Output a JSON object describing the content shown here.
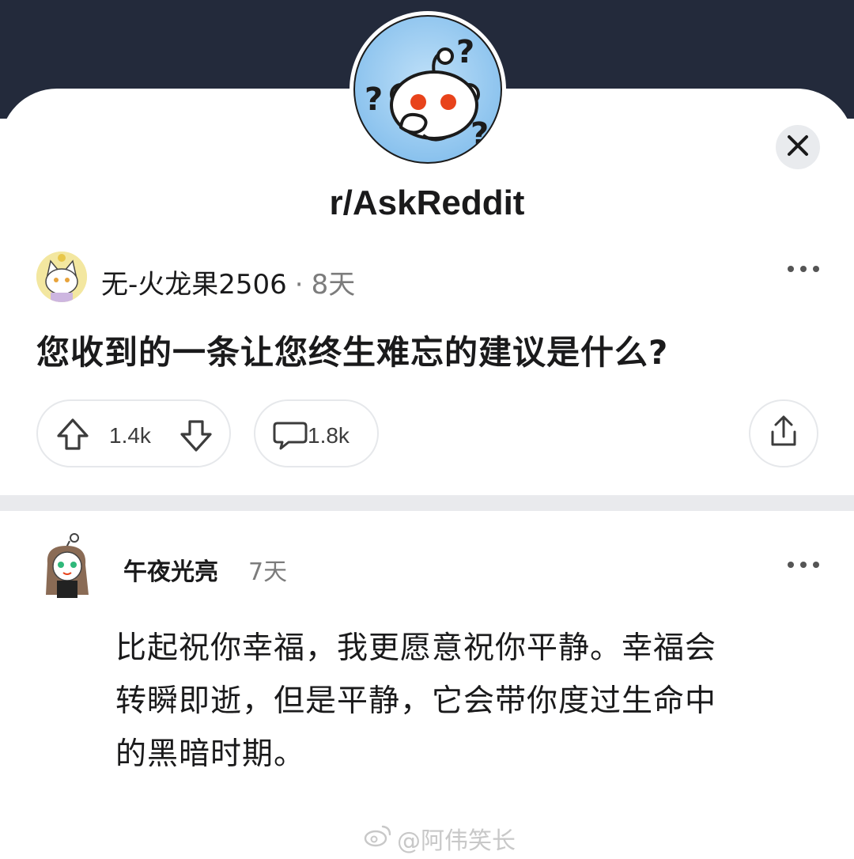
{
  "subreddit": {
    "name": "r/AskReddit"
  },
  "post": {
    "author": "无-火龙果2506",
    "separator": "·",
    "age": "8天",
    "title": "您收到的一条让您终生难忘的建议是什么?",
    "upvotes": "1.4k",
    "comments": "1.8k"
  },
  "comment": {
    "author": "午夜光亮",
    "age": "7天",
    "lines": [
      "比起祝你幸福，我更愿意祝你平静。幸福会",
      "转瞬即逝，但是平静，它会带你度过生命中",
      "的黑暗时期。"
    ]
  },
  "watermark": {
    "text": "@阿伟笑长"
  },
  "icons": {
    "close": "close-icon",
    "more": "more-options-icon",
    "upvote": "upvote-arrow-icon",
    "downvote": "downvote-arrow-icon",
    "comment": "comment-bubble-icon",
    "share": "share-icon",
    "watermark": "weibo-logo-icon"
  },
  "colors": {
    "header_bg": "#232a3b",
    "divider": "#e9eaed",
    "muted_text": "#7c7c7c",
    "snoo_eye": "#e8431b",
    "avatar_bg": "#8cc3ee"
  }
}
